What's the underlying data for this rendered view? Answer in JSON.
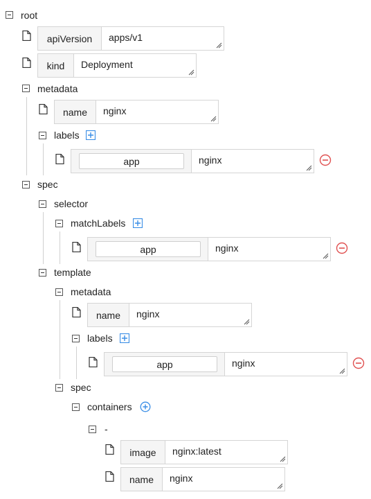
{
  "tree": {
    "root_label": "root",
    "api_version": {
      "key": "apiVersion",
      "value": "apps/v1"
    },
    "kind": {
      "key": "kind",
      "value": "Deployment"
    },
    "metadata": {
      "label": "metadata",
      "name": {
        "key": "name",
        "value": "nginx"
      },
      "labels": {
        "label": "labels",
        "entries": [
          {
            "key": "app",
            "value": "nginx"
          }
        ]
      }
    },
    "spec": {
      "label": "spec",
      "selector": {
        "label": "selector",
        "match_labels": {
          "label": "matchLabels",
          "entries": [
            {
              "key": "app",
              "value": "nginx"
            }
          ]
        }
      },
      "template": {
        "label": "template",
        "metadata": {
          "label": "metadata",
          "name": {
            "key": "name",
            "value": "nginx"
          },
          "labels": {
            "label": "labels",
            "entries": [
              {
                "key": "app",
                "value": "nginx"
              }
            ]
          }
        },
        "spec": {
          "label": "spec",
          "containers": {
            "label": "containers",
            "item_label": "-",
            "image": {
              "key": "image",
              "value": "nginx:latest"
            },
            "name": {
              "key": "name",
              "value": "nginx"
            }
          }
        }
      }
    }
  },
  "colors": {
    "add_icon": "#3a8ee6",
    "remove_icon": "#e05050",
    "guide_line": "#d0d0d0"
  }
}
